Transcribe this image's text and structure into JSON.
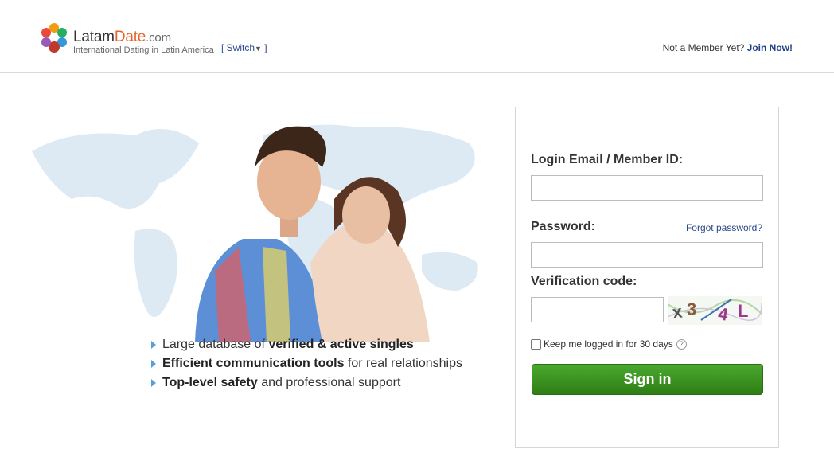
{
  "header": {
    "brand_main": "Latam",
    "brand_accent": "Date",
    "brand_tld": ".com",
    "tagline": "International Dating in Latin America",
    "switch_label": "[ Switch",
    "switch_close": "]",
    "member_prompt": "Not a Member Yet?",
    "join_label": "Join Now!"
  },
  "features": [
    {
      "pre": "Large database of ",
      "bold": "verified & active singles",
      "post": ""
    },
    {
      "pre": "",
      "bold": "Efficient communication tools",
      "post": " for real relationships"
    },
    {
      "pre": "",
      "bold": "Top-level safety",
      "post": " and professional support"
    }
  ],
  "login": {
    "email_label": "Login Email / Member ID:",
    "email_value": "",
    "password_label": "Password:",
    "password_value": "",
    "forgot_label": "Forgot password?",
    "verification_label": "Verification code:",
    "verification_value": "",
    "captcha_text": "x34L",
    "keep_label": "Keep me logged in for 30 days",
    "help_glyph": "?",
    "signin_label": "Sign in"
  },
  "colors": {
    "accent": "#e8632c",
    "link": "#1e3f86",
    "signin_green": "#3a9120",
    "map": "#dbe9f4"
  }
}
